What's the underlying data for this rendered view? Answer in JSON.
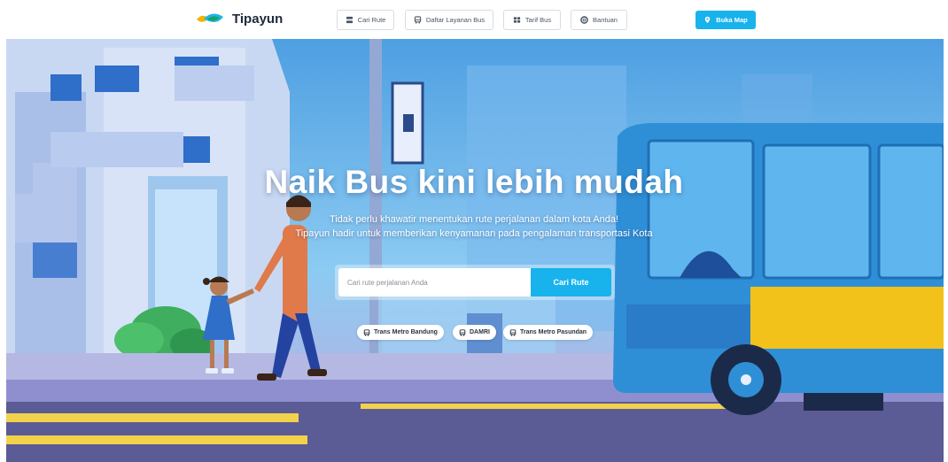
{
  "brand": {
    "name": "Tipayun"
  },
  "nav": {
    "items": [
      {
        "label": "Cari Rute",
        "icon": "route-icon"
      },
      {
        "label": "Daftar Layanan Bus",
        "icon": "bus-icon"
      },
      {
        "label": "Tarif Bus",
        "icon": "fare-icon"
      },
      {
        "label": "Bantuan",
        "icon": "help-icon"
      }
    ],
    "map_button": {
      "label": "Buka Map",
      "icon": "map-pin-icon"
    }
  },
  "hero": {
    "title": "Naik Bus kini lebih mudah",
    "subtitle_line1": "Tidak perlu khawatir menentukan rute perjalanan dalam kota Anda!",
    "subtitle_line2": "Tipayun hadir untuk memberikan kenyamanan pada pengalaman transportasi Kota"
  },
  "search": {
    "placeholder": "Cari rute perjalanan Anda",
    "button_label": "Cari Rute"
  },
  "services": [
    {
      "label": "Trans Metro Bandung",
      "icon": "bus-icon"
    },
    {
      "label": "DAMRI",
      "icon": "bus-icon"
    },
    {
      "label": "Trans Metro Pasundan",
      "icon": "bus-icon"
    }
  ],
  "colors": {
    "accent": "#18b3ec",
    "brand_dark": "#1e2a3a",
    "bus_blue": "#2f8fd6",
    "bus_yellow": "#f2c21b"
  }
}
